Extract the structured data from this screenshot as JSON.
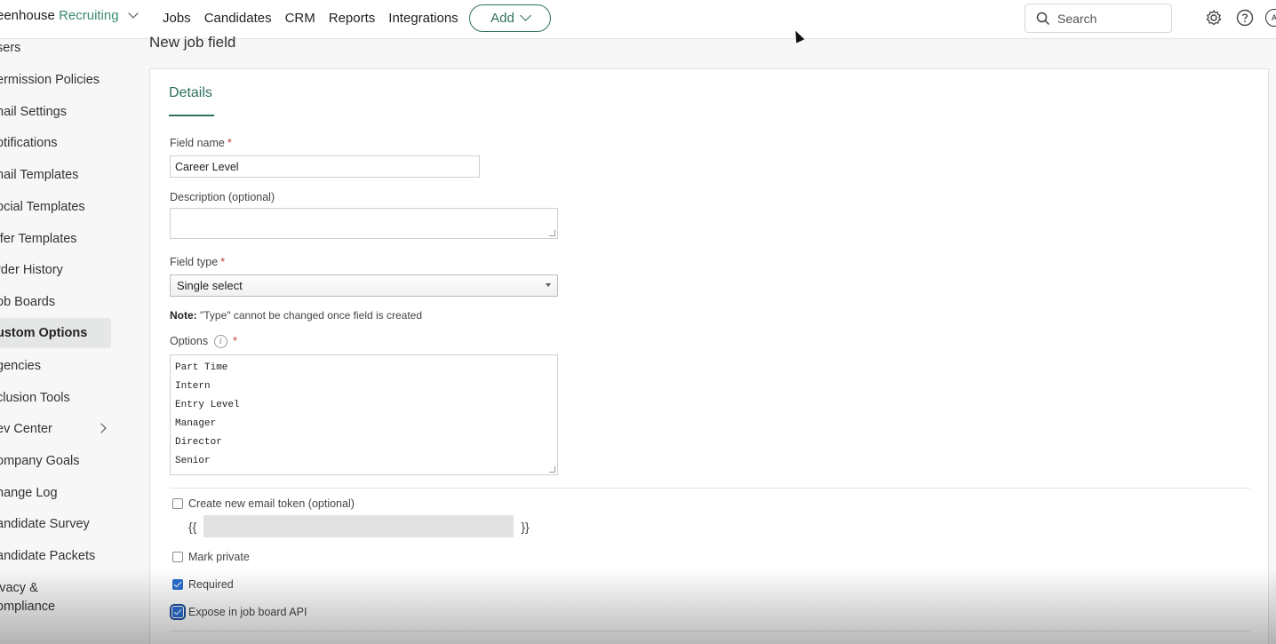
{
  "header": {
    "brand_main": "eenhouse",
    "brand_accent": "Recruiting",
    "nav": [
      "Jobs",
      "Candidates",
      "CRM",
      "Reports",
      "Integrations"
    ],
    "add_label": "Add",
    "search_placeholder": "Search",
    "avatar_text": "A"
  },
  "sidebar": {
    "items": [
      "sers",
      "ermission Policies",
      "nail Settings",
      "otifications",
      "nail Templates",
      "ocial Templates",
      "ffer Templates",
      "rder History",
      "ob Boards",
      "ustom Options",
      "gencies",
      "clusion Tools",
      "ev Center",
      "ompany Goals",
      "hange Log",
      "andidate Survey",
      "andidate Packets",
      "ivacy &",
      "ompliance"
    ],
    "active_index": 9
  },
  "page": {
    "title": "New job field",
    "tab": "Details"
  },
  "form": {
    "field_name_label": "Field name",
    "field_name_value": "Career Level",
    "required_mark": "*",
    "description_label": "Description (optional)",
    "field_type_label": "Field type",
    "field_type_value": "Single select",
    "note_bold": "Note:",
    "note_text": " \"Type\" cannot be changed once field is created",
    "options_label": "Options",
    "info_glyph": "i",
    "options": [
      "Part Time",
      "Intern",
      "Entry Level",
      "Manager",
      "Director",
      "Senior"
    ],
    "email_token_label": "Create new email token (optional)",
    "token_open": "{{",
    "token_close": "}}",
    "mark_private_label": "Mark private",
    "required_label": "Required",
    "expose_label": "Expose in job board API"
  },
  "checkbox_states": {
    "email_token": false,
    "mark_private": false,
    "required": true,
    "expose": true
  },
  "colors": {
    "accent": "#2f6f5e",
    "checkbox": "#2b6fd1",
    "required": "#c0392b"
  }
}
